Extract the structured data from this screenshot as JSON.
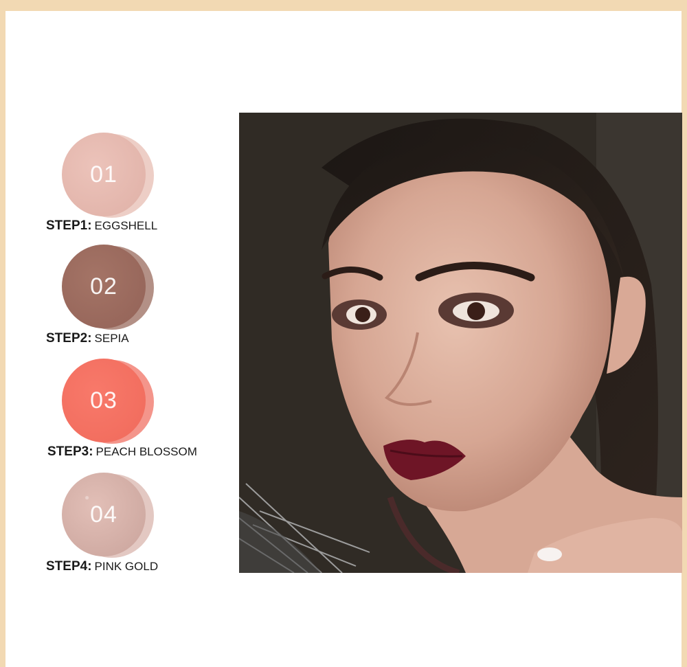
{
  "steps": [
    {
      "number": "01",
      "step_label": "STEP1:",
      "name": "EGGSHELL",
      "color": "#e4b8ae"
    },
    {
      "number": "02",
      "step_label": "STEP2:",
      "name": "SEPIA",
      "color": "#9a6a5d"
    },
    {
      "number": "03",
      "step_label": "STEP3:",
      "name": "PEACH BLOSSOM",
      "color": "#f37060"
    },
    {
      "number": "04",
      "step_label": "STEP4:",
      "name": "PINK GOLD",
      "color": "#d6b0a8"
    }
  ],
  "colors": {
    "frame": "#f2d9b3",
    "background": "#ffffff"
  }
}
